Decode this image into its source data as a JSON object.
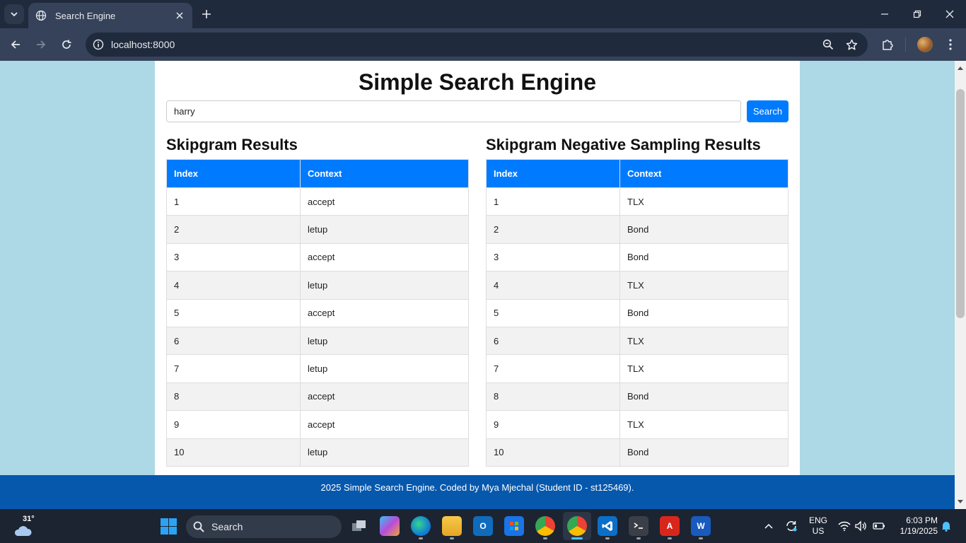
{
  "browser": {
    "tab_title": "Search Engine",
    "url": "localhost:8000"
  },
  "page": {
    "title": "Simple Search Engine",
    "search": {
      "value": "harry",
      "button_label": "Search"
    },
    "tables": [
      {
        "heading": "Skipgram Results",
        "columns": [
          "Index",
          "Context"
        ],
        "rows": [
          [
            "1",
            "accept"
          ],
          [
            "2",
            "letup"
          ],
          [
            "3",
            "accept"
          ],
          [
            "4",
            "letup"
          ],
          [
            "5",
            "accept"
          ],
          [
            "6",
            "letup"
          ],
          [
            "7",
            "letup"
          ],
          [
            "8",
            "accept"
          ],
          [
            "9",
            "accept"
          ],
          [
            "10",
            "letup"
          ]
        ]
      },
      {
        "heading": "Skipgram Negative Sampling Results",
        "columns": [
          "Index",
          "Context"
        ],
        "rows": [
          [
            "1",
            "TLX"
          ],
          [
            "2",
            "Bond"
          ],
          [
            "3",
            "Bond"
          ],
          [
            "4",
            "TLX"
          ],
          [
            "5",
            "Bond"
          ],
          [
            "6",
            "TLX"
          ],
          [
            "7",
            "TLX"
          ],
          [
            "8",
            "Bond"
          ],
          [
            "9",
            "TLX"
          ],
          [
            "10",
            "Bond"
          ]
        ]
      }
    ],
    "footer": "2025 Simple Search Engine. Coded by Mya Mjechal (Student ID - st125469)."
  },
  "taskbar": {
    "weather_temp": "31°",
    "search_label": "Search",
    "lang_line1": "ENG",
    "lang_line2": "US",
    "time": "6:03 PM",
    "date": "1/19/2025"
  },
  "colors": {
    "accent": "#007bff",
    "page_background": "#add8e6",
    "footer": "#0658ad"
  }
}
